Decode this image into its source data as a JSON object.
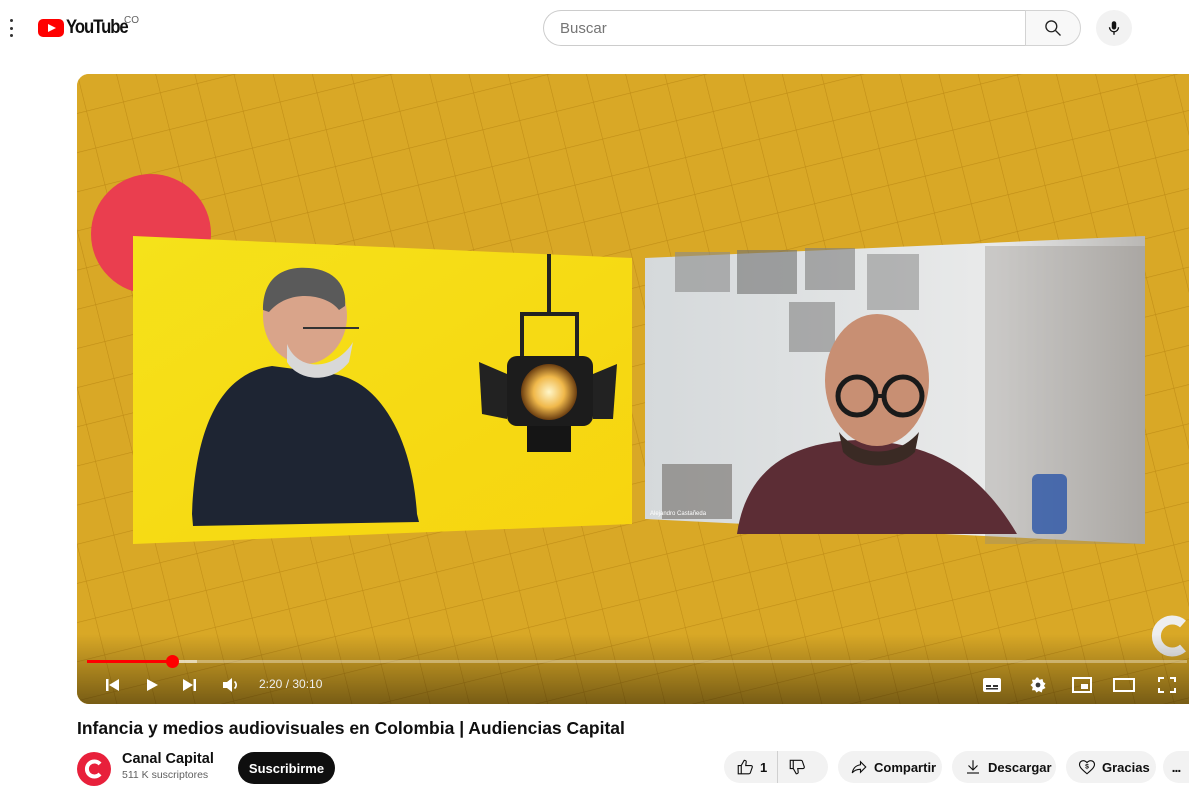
{
  "header": {
    "logo_text": "YouTube",
    "country_code": "CO",
    "search_placeholder": "Buscar",
    "icons": [
      "menu-icon",
      "search-icon",
      "mic-icon"
    ]
  },
  "player": {
    "current_time": "2:20",
    "duration": "30:10",
    "time_display": "2:20 / 30:10",
    "played_fraction": 0.0773,
    "buffered_fraction": 0.1,
    "overlay_name": "Alejandro Castañeda",
    "icons": [
      "previous-icon",
      "play-icon",
      "next-icon",
      "volume-icon",
      "subtitles-icon",
      "settings-icon",
      "miniplayer-icon",
      "theater-mode-icon",
      "fullscreen-icon"
    ]
  },
  "video": {
    "title": "Infancia y medios audiovisuales en Colombia | Audiencias Capital"
  },
  "channel": {
    "name": "Canal Capital",
    "subscribers": "511 K suscriptores",
    "subscribe_label": "Suscribirme"
  },
  "actions": {
    "like_count": "1",
    "share_label": "Compartir",
    "download_label": "Descargar",
    "thanks_label": "Gracias",
    "more_label": "..."
  },
  "colors": {
    "accent_red": "#ff0000",
    "video_background": "#d7a624",
    "subscribe_button": "#0f0f0f",
    "channel_avatar": "#e8203b"
  }
}
